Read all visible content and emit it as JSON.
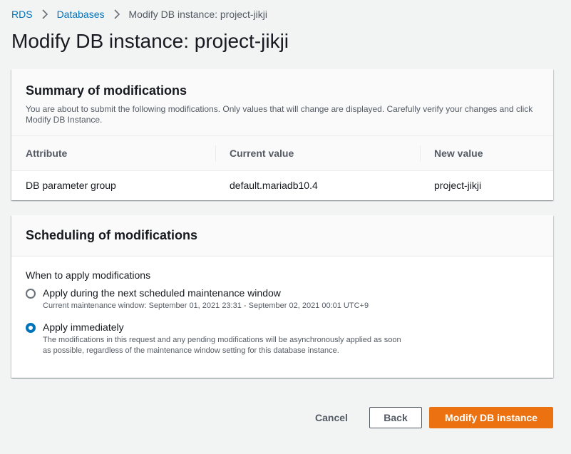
{
  "breadcrumb": {
    "items": [
      "RDS",
      "Databases"
    ],
    "current": "Modify DB instance: project-jikji"
  },
  "page_title": "Modify DB instance: project-jikji",
  "summary": {
    "title": "Summary of modifications",
    "description": "You are about to submit the following modifications. Only values that will change are displayed. Carefully verify your changes and click Modify DB Instance.",
    "columns": [
      "Attribute",
      "Current value",
      "New value"
    ],
    "rows": [
      [
        "DB parameter group",
        "default.mariadb10.4",
        "project-jikji"
      ]
    ]
  },
  "scheduling": {
    "title": "Scheduling of modifications",
    "when_label": "When to apply modifications",
    "options": [
      {
        "label": "Apply during the next scheduled maintenance window",
        "description": "Current maintenance window: September 01, 2021 23:31 - September 02, 2021 00:01 UTC+9",
        "selected": false
      },
      {
        "label": "Apply immediately",
        "description": "The modifications in this request and any pending modifications will be asynchronously applied as soon as possible, regardless of the maintenance window setting for this database instance.",
        "selected": true
      }
    ]
  },
  "actions": {
    "cancel": "Cancel",
    "back": "Back",
    "submit": "Modify DB instance"
  },
  "colors": {
    "link": "#0073bb",
    "primary_button": "#ec7211",
    "background": "#f2f3f3"
  }
}
